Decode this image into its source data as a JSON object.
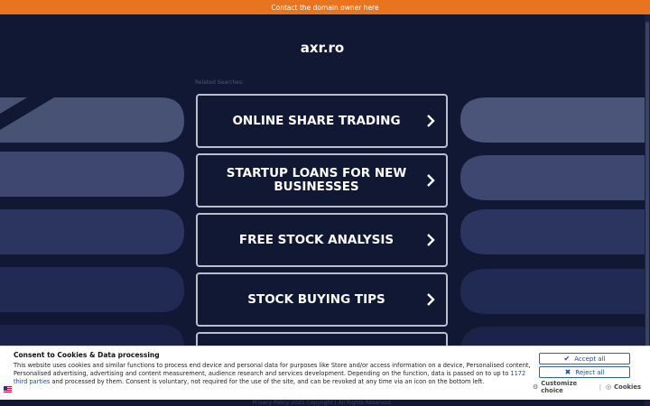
{
  "top_bar": {
    "text": "Contact the domain owner here"
  },
  "domain": {
    "title": "axr.ro"
  },
  "related_label": "Related Searches:",
  "searches": [
    {
      "line1": "ONLINE SHARE TRADING",
      "line2": ""
    },
    {
      "line1": "STARTUP LOANS FOR NEW",
      "line2": "BUSINESSES"
    },
    {
      "line1": "FREE STOCK ANALYSIS",
      "line2": ""
    },
    {
      "line1": "STOCK BUYING TIPS",
      "line2": ""
    }
  ],
  "footer": {
    "text": "Privacy Policy   2025 Copyright | All Rights Reserved."
  },
  "cookie": {
    "title": "Consent to Cookies & Data processing",
    "text_before": "This website uses cookies and similar functions to process end device and personal data for purposes like Store and/or access information on a device, Personalised content, Personalised advertising, advertising and content measurement, audience research and services development. Depending on the function, data is passed on to up to ",
    "link_text": "1172 third parties",
    "text_after": " and processed by them. Consent is voluntary, not required for the use of the site, and can be revoked at any time via an icon on the bottom left.",
    "accept_all": "Accept all",
    "reject_all": "Reject all",
    "customize": "Customize choice",
    "cookies": "Cookies",
    "separator": "|"
  },
  "colors": {
    "top_bar": "#e9741f",
    "background": "#111833",
    "button_border": "#b9bfcf",
    "cookie_button": "#1f4f9e"
  }
}
